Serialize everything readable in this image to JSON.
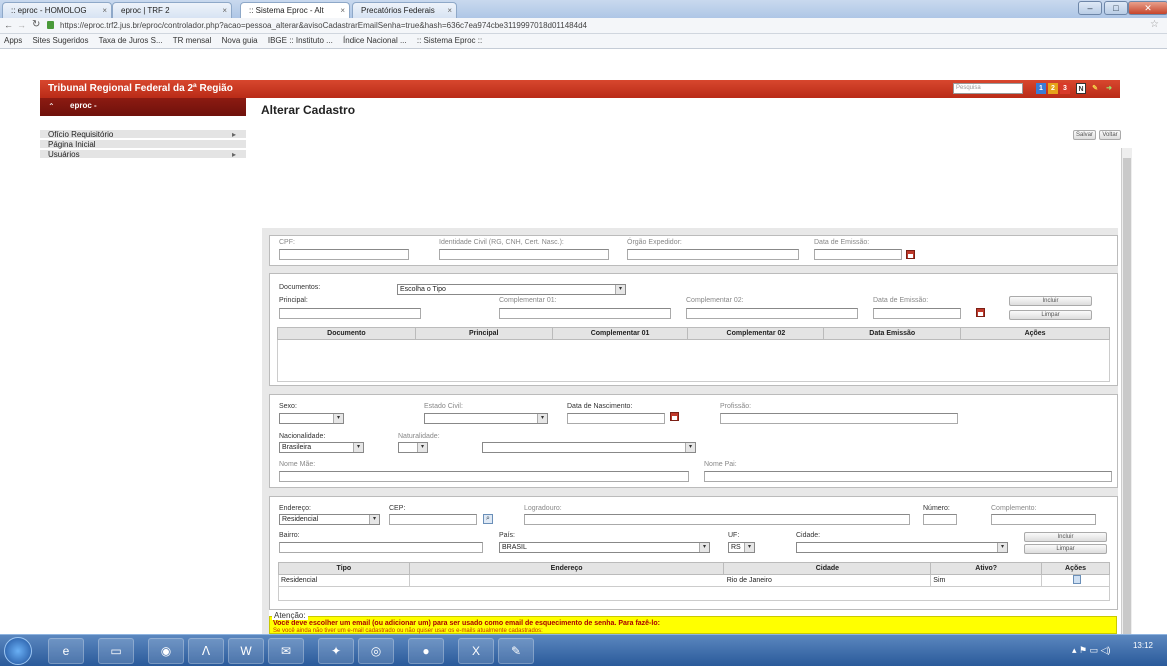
{
  "browser": {
    "tabs": [
      {
        "label": ":: eproc - HOMOLOG",
        "active": false
      },
      {
        "label": "eproc | TRF 2",
        "active": false
      },
      {
        "label": ":: Sistema Eproc - Alt",
        "active": true
      },
      {
        "label": "Precatórios Federais",
        "active": false
      }
    ],
    "url": "https://eproc.trf2.jus.br/eproc/controlador.php?acao=pessoa_alterar&avisoCadastrarEmailSenha=true&hash=636c7ea974cbe3119997018d011484d4",
    "bookmarks": [
      "Apps",
      "Sites Sugeridos",
      "Taxa de Juros S...",
      "TR mensal",
      "Nova guia",
      "IBGE :: Instituto ...",
      "Índice Nacional ...",
      ":: Sistema Eproc ::"
    ]
  },
  "app": {
    "header_title": "Tribunal Regional Federal da 2ª Região",
    "search_placeholder": "Pesquisa",
    "header_badges": [
      "1",
      "2",
      "3"
    ],
    "sidebar_title": "eproc -",
    "menu": [
      {
        "label": "Ofício Requisitório",
        "has_arrow": true
      },
      {
        "label": "Página Inicial",
        "has_arrow": false
      },
      {
        "label": "Usuários",
        "has_arrow": true
      }
    ],
    "page_title": "Alterar Cadastro",
    "save_label": "Salvar",
    "back_label": "Voltar"
  },
  "identity": {
    "cpf_label": "CPF:",
    "identity_label": "Identidade Civil (RG, CNH, Cert. Nasc.):",
    "issuer_label": "Órgão Expedidor:",
    "issue_date_label": "Data de Emissão:"
  },
  "documents": {
    "documents_label": "Documentos:",
    "documents_select": "Escolha o Tipo",
    "principal_label": "Principal:",
    "comp1_label": "Complementar 01:",
    "comp2_label": "Complementar 02:",
    "issue_date_label": "Data de Emissão:",
    "include_label": "Incluir",
    "clear_label": "Limpar",
    "columns": [
      "Documento",
      "Principal",
      "Complementar 01",
      "Complementar 02",
      "Data Emissão",
      "Ações"
    ]
  },
  "personal": {
    "sex_label": "Sexo:",
    "civil_label": "Estado Civil:",
    "birth_label": "Data de Nascimento:",
    "profession_label": "Profissão:",
    "nationality_label": "Nacionalidade:",
    "nationality_value": "Brasileira",
    "naturality_label": "Naturalidade:",
    "mother_label": "Nome Mãe:",
    "father_label": "Nome Pai:"
  },
  "address": {
    "address_label": "Endereço:",
    "address_type": "Residencial",
    "cep_label": "CEP:",
    "street_label": "Logradouro:",
    "number_label": "Número:",
    "complement_label": "Complemento:",
    "district_label": "Bairro:",
    "country_label": "País:",
    "country_value": "BRASIL",
    "uf_label": "UF:",
    "uf_value": "RS",
    "city_label": "Cidade:",
    "include_label": "Incluir",
    "clear_label": "Limpar",
    "columns": [
      "Tipo",
      "Endereço",
      "Cidade",
      "Ativo?",
      "Ações"
    ],
    "rows": [
      {
        "tipo": "Residencial",
        "endereco": "",
        "cidade": "Rio de Janeiro",
        "ativo": "Sim"
      }
    ]
  },
  "alert": {
    "title": "Atenção:",
    "line1": "Você deve escolher um email (ou adicionar um) para ser usado como email de esquecimento de senha. Para fazê-lo:",
    "line2": "Se você ainda não tiver um e-mail cadastrado ou não quiser usar os e-mails atualmente cadastrados:"
  },
  "taskbar": {
    "time": "13:12"
  }
}
